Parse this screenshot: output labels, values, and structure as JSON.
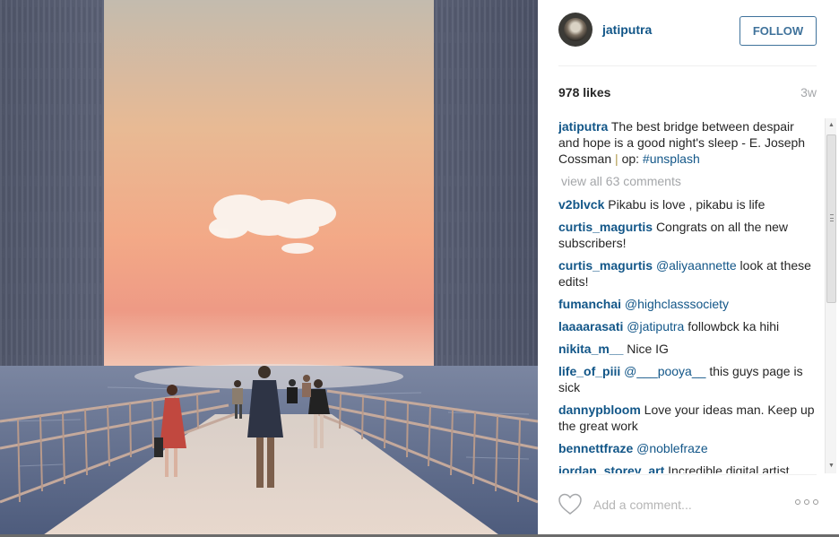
{
  "post": {
    "username": "jatiputra",
    "follow_label": "FOLLOW",
    "likes": "978 likes",
    "age": "3w",
    "caption": {
      "author": "jatiputra",
      "text": "The best bridge between despair and hope is a good night's sleep - E. Joseph Cossman",
      "separator": "|",
      "op_label": "op:",
      "hashtag": "#unsplash"
    },
    "view_all": "view all 63 comments",
    "comments": [
      {
        "author": "v2blvck",
        "mention": "",
        "text": "Pikabu is love , pikabu is life"
      },
      {
        "author": "curtis_magurtis",
        "mention": "",
        "text": "Congrats on all the new subscribers!"
      },
      {
        "author": "curtis_magurtis",
        "mention": "@aliyaannette",
        "text": "look at these edits!"
      },
      {
        "author": "fumanchai",
        "mention": "@highclasssociety",
        "text": ""
      },
      {
        "author": "laaaarasati",
        "mention": "@jatiputra",
        "text": "followbck ka hihi"
      },
      {
        "author": "nikita_m__",
        "mention": "",
        "text": "Nice IG"
      },
      {
        "author": "life_of_piii",
        "mention": "@___pooya__",
        "text": "this guys page is sick"
      },
      {
        "author": "dannypbloom",
        "mention": "",
        "text": "Love your ideas man. Keep up the great work"
      },
      {
        "author": "bennettfraze",
        "mention": "@noblefraze",
        "text": ""
      },
      {
        "author": "jordan_storey_art",
        "mention": "",
        "text": "Incredible digital artist"
      }
    ],
    "add_comment_placeholder": "Add a comment...",
    "icons": {
      "like": "heart-icon",
      "more": "more-options-icon",
      "scroll_up": "scroll-up-arrow-icon",
      "scroll_down": "scroll-down-arrow-icon"
    },
    "colors": {
      "link": "#125688",
      "follow_border": "#3f729b",
      "muted": "#a5a7aa"
    }
  }
}
